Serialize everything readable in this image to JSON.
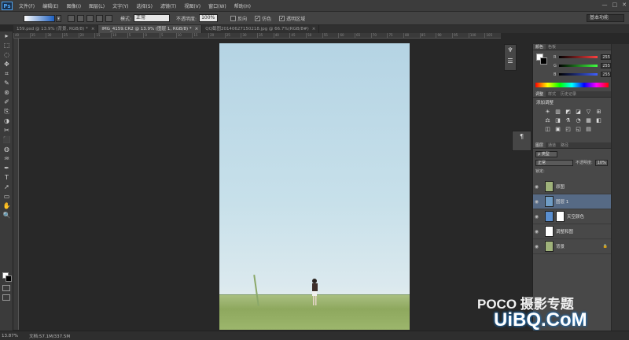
{
  "app": {
    "logo": "Ps"
  },
  "menu": [
    "文件(F)",
    "编辑(E)",
    "图像(I)",
    "图层(L)",
    "文字(Y)",
    "选择(S)",
    "滤镜(T)",
    "视图(V)",
    "窗口(W)",
    "帮助(H)"
  ],
  "window_controls": [
    "—",
    "□",
    "✕"
  ],
  "options": {
    "mode_label": "模式:",
    "mode_value": "正常",
    "opacity_label": "不透明度:",
    "opacity_value": "100%",
    "reverse_label": "反向",
    "dither_label": "仿色",
    "transparency_label": "透明区域",
    "dither_checked": "✓",
    "transparency_checked": "✓",
    "workspace": "基本功能"
  },
  "tabs": [
    {
      "label": "159.psd @ 13.9% (背景, RGB/8) *",
      "close": "×"
    },
    {
      "label": "IMG_4159.CR2 @ 13.9% (图层 1, RGB/8) *",
      "close": "×"
    },
    {
      "label": "QQ截图20140627150218.jpg @ 66.7%(RGB/8#)",
      "close": "×"
    }
  ],
  "ruler_ticks": [
    "40",
    "35",
    "30",
    "25",
    "20",
    "15",
    "10",
    "5",
    "0",
    "5",
    "10",
    "15",
    "20",
    "25",
    "30",
    "35",
    "40",
    "45",
    "50",
    "55",
    "60",
    "65",
    "70",
    "75",
    "80",
    "85",
    "90",
    "95",
    "100",
    "105"
  ],
  "tools": [
    "▸",
    "⬚",
    "◌",
    "✥",
    "⌗",
    "✎",
    "⊛",
    "✐",
    "⎘",
    "◑",
    "✂",
    "⬛",
    "◍",
    "♒",
    "✒",
    "T",
    "➚",
    "▭",
    "✋",
    "🔍"
  ],
  "color_panel": {
    "tabs": [
      "颜色",
      "色板"
    ],
    "rows": [
      {
        "label": "R",
        "value": "255",
        "color": "#ff4040"
      },
      {
        "label": "G",
        "value": "255",
        "color": "#40ff40"
      },
      {
        "label": "B",
        "value": "255",
        "color": "#4060ff"
      }
    ]
  },
  "adjust_panel": {
    "tabs": [
      "调整",
      "样式",
      "历史记录"
    ],
    "title": "添加调整",
    "icons": [
      "☀",
      "▥",
      "◩",
      "◪",
      "▽",
      "⊞",
      "⚖",
      "◨",
      "⚗",
      "◔",
      "▦",
      "◧",
      "◫",
      "▣",
      "◰",
      "◱",
      "▤"
    ]
  },
  "layers_panel": {
    "tabs": [
      "图层",
      "通道",
      "路径"
    ],
    "kind_label": "ρ 类型",
    "blend_value": "正常",
    "opacity_label": "不透明度:",
    "opacity_value": "10%",
    "lock_label": "锁定:",
    "layers": [
      {
        "name": "原图",
        "thumb": "#9fb27a",
        "selected": false,
        "mask": false
      },
      {
        "name": "图层 1",
        "thumb": "#6f9cc4",
        "selected": true,
        "mask": false
      },
      {
        "name": "天空颜色",
        "thumb": "#5a8fd0",
        "selected": false,
        "mask": true
      },
      {
        "name": "调整和图",
        "thumb": "#ffffff",
        "selected": false,
        "mask": false
      },
      {
        "name": "背景",
        "thumb": "#9fb27a",
        "selected": false,
        "mask": false,
        "lock": "🔒"
      }
    ]
  },
  "status": {
    "zoom": "13.87%",
    "doc": "文档:57.1M/337.5M"
  },
  "watermark": {
    "line1": "POCO 摄影专题",
    "line2": "UiBQ.CoM"
  },
  "colors": {
    "accent": "#566a85",
    "brand": "#4ea3f0"
  }
}
